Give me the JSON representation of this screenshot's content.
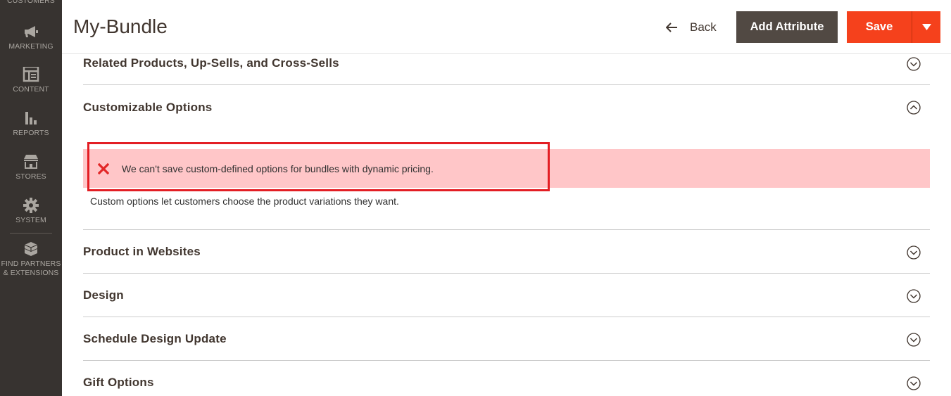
{
  "sidebar": {
    "items": [
      {
        "label": "Customers",
        "icon": "customers-icon"
      },
      {
        "label": "Marketing",
        "icon": "megaphone-icon"
      },
      {
        "label": "Content",
        "icon": "layout-icon"
      },
      {
        "label": "Reports",
        "icon": "bar-chart-icon"
      },
      {
        "label": "Stores",
        "icon": "storefront-icon"
      },
      {
        "label": "System",
        "icon": "gear-icon"
      },
      {
        "label": "Find Partners & Extensions",
        "icon": "cubes-icon"
      }
    ]
  },
  "header": {
    "title": "My-Bundle",
    "back_label": "Back",
    "add_attribute_label": "Add Attribute",
    "save_label": "Save"
  },
  "sections": [
    {
      "title": "Related Products, Up-Sells, and Cross-Sells",
      "expanded": false
    },
    {
      "title": "Customizable Options",
      "expanded": true
    },
    {
      "title": "Product in Websites",
      "expanded": false
    },
    {
      "title": "Design",
      "expanded": false
    },
    {
      "title": "Schedule Design Update",
      "expanded": false
    },
    {
      "title": "Gift Options",
      "expanded": false
    }
  ],
  "customizable_options": {
    "error_message": "We can't save custom-defined options for bundles with dynamic pricing.",
    "help_text": "Custom options let customers choose the product variations they want."
  },
  "colors": {
    "sidebar_bg": "#373330",
    "primary_button": "#f5411c",
    "secondary_button": "#514943",
    "error_bg": "#ffc6c8",
    "error_icon": "#e22626",
    "highlight_border": "#e31e24"
  }
}
